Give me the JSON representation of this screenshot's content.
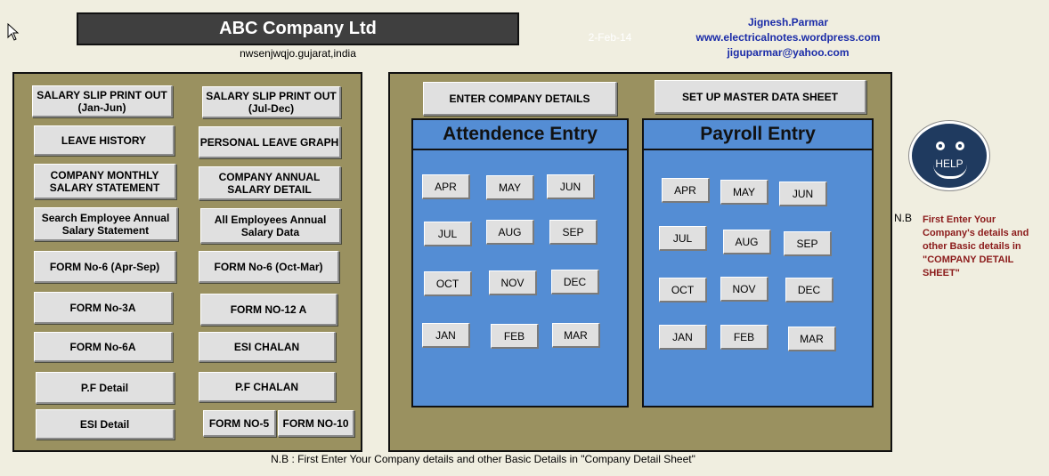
{
  "header": {
    "company_name": "ABC Company Ltd",
    "address": "nwsenjwqjo.gujarat,india",
    "date": "2-Feb-14",
    "author": "Jignesh.Parmar",
    "website": "www.electricalnotes.wordpress.com",
    "email": "jiguparmar@yahoo.com"
  },
  "left_panel": {
    "buttons": [
      "SALARY SLIP  PRINT OUT  (Jan-Jun)",
      "SALARY SLIP  PRINT OUT  (Jul-Dec)",
      "LEAVE HISTORY",
      "PERSONAL LEAVE GRAPH",
      "COMPANY MONTHLY SALARY STATEMENT",
      "COMPANY ANNUAL SALARY DETAIL",
      "Search Employee Annual Salary Statement",
      "All Employees Annual Salary Data",
      "FORM No-6 (Apr-Sep)",
      "FORM No-6 (Oct-Mar)",
      "FORM No-3A",
      "FORM NO-12 A",
      "FORM No-6A",
      "ESI CHALAN",
      "P.F Detail",
      "P.F CHALAN",
      "ESI Detail",
      "FORM NO-5",
      "FORM NO-10"
    ]
  },
  "right_panel": {
    "enter_company_details": "ENTER COMPANY DETAILS",
    "setup_master_sheet": "SET UP MASTER DATA SHEET",
    "attendance_title": "Attendence Entry",
    "payroll_title": "Payroll Entry",
    "months": [
      "APR",
      "MAY",
      "JUN",
      "JUL",
      "AUG",
      "SEP",
      "OCT",
      "NOV",
      "DEC",
      "JAN",
      "FEB",
      "MAR"
    ]
  },
  "help": {
    "label": "HELP"
  },
  "note": {
    "label": "N.B",
    "text": "First Enter Your Company's  details and other Basic details in \"COMPANY DETAIL SHEET\""
  },
  "footer": "N.B : First Enter Your Company details and other Basic Details in \"Company Detail Sheet\"",
  "colors": {
    "panel": "#9a9160",
    "entry_box": "#548dd4",
    "title_bar": "#3f3f3f",
    "contact_text": "#1b2ca8",
    "note_text": "#8b1a1a"
  }
}
